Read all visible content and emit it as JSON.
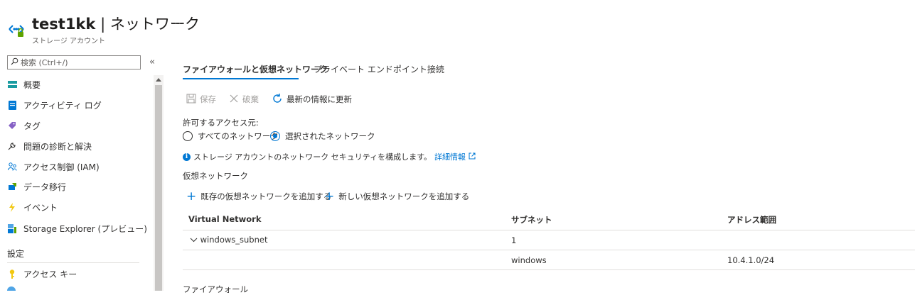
{
  "header": {
    "resource_name": "test1kk",
    "separator": "|",
    "page_title": "ネットワーク",
    "subtitle": "ストレージ アカウント",
    "more": "..."
  },
  "sidebar": {
    "search_placeholder": "検索 (Ctrl+/)",
    "collapse": "«",
    "items": [
      {
        "label": "概要",
        "icon": "overview-icon"
      },
      {
        "label": "アクティビティ ログ",
        "icon": "activity-log-icon"
      },
      {
        "label": "タグ",
        "icon": "tag-icon"
      },
      {
        "label": "問題の診断と解決",
        "icon": "wrench-icon"
      },
      {
        "label": "アクセス制御 (IAM)",
        "icon": "people-icon"
      },
      {
        "label": "データ移行",
        "icon": "data-migration-icon"
      },
      {
        "label": "イベント",
        "icon": "lightning-icon"
      },
      {
        "label": "Storage Explorer (プレビュー)",
        "icon": "storage-explorer-icon"
      }
    ],
    "section_settings": "設定",
    "settings_items": [
      {
        "label": "アクセス キー",
        "icon": "key-icon"
      }
    ]
  },
  "tabs": [
    {
      "label": "ファイアウォールと仮想ネットワーク",
      "active": true
    },
    {
      "label": "プライベート エンドポイント接続",
      "active": false
    }
  ],
  "toolbar": {
    "save": "保存",
    "discard": "破棄",
    "refresh": "最新の情報に更新"
  },
  "access": {
    "label": "許可するアクセス元:",
    "options": [
      {
        "label": "すべてのネットワーク",
        "selected": false
      },
      {
        "label": "選択されたネットワーク",
        "selected": true
      }
    ]
  },
  "info": {
    "text": "ストレージ アカウントのネットワーク セキュリティを構成します。",
    "link": "詳細情報"
  },
  "vnet": {
    "heading": "仮想ネットワーク",
    "add_existing": "既存の仮想ネットワークを追加する",
    "add_new": "新しい仮想ネットワークを追加する",
    "columns": [
      "Virtual Network",
      "サブネット",
      "アドレス範囲"
    ],
    "rows": [
      {
        "network": "windows_subnet",
        "subnet": "1",
        "range": "",
        "expandable": true
      },
      {
        "network": "",
        "subnet": "windows",
        "range": "10.4.1.0/24",
        "expandable": false
      }
    ]
  },
  "firewall_heading": "ファイアウォール",
  "colors": {
    "accent": "#0078d4",
    "disabled": "#a19f9d",
    "border": "#e1dfdd"
  }
}
